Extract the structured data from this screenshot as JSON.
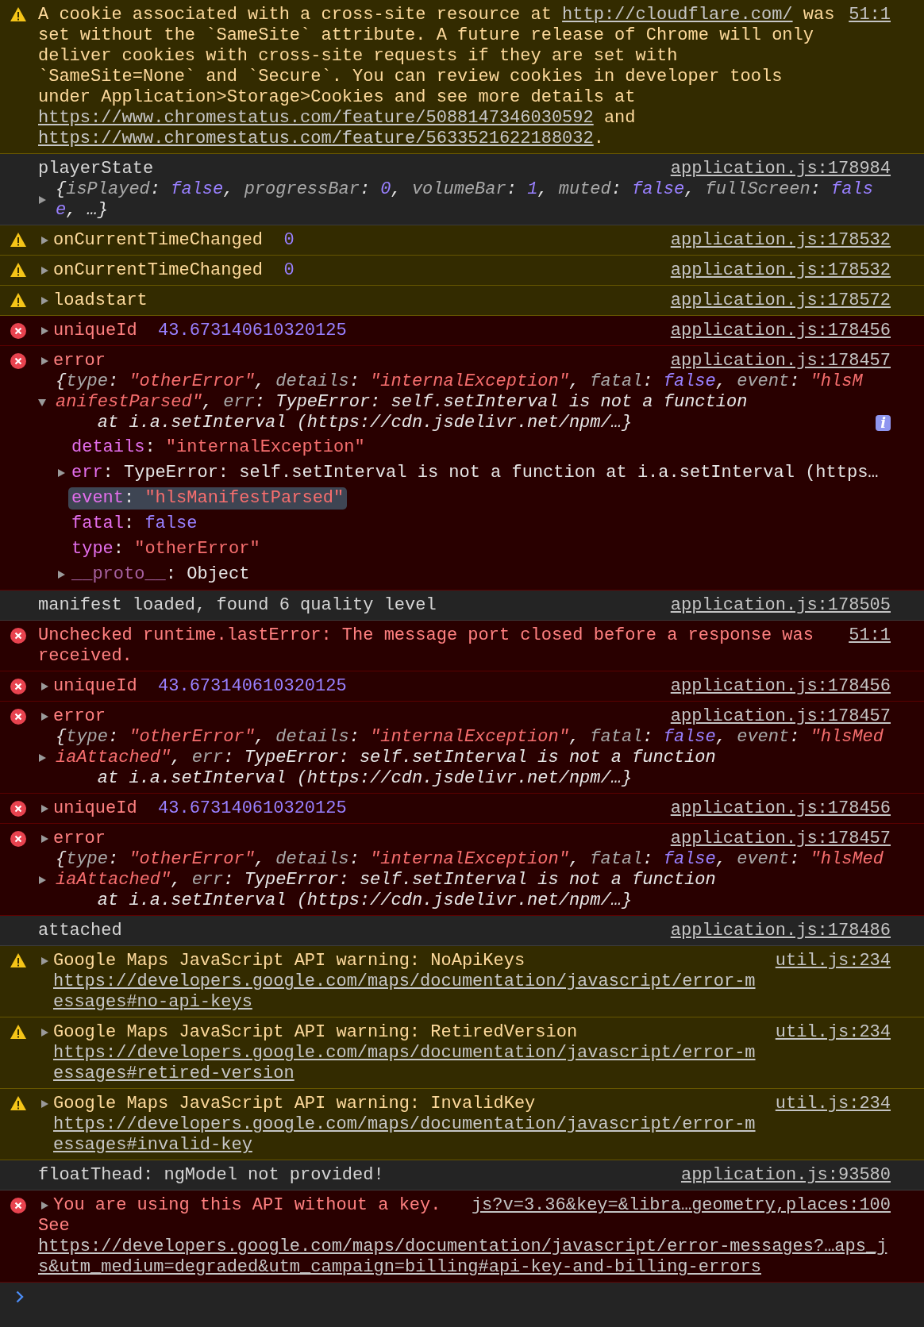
{
  "messages": [
    {
      "kind": "warning",
      "expandable": false,
      "source": "51:1",
      "parts": [
        {
          "kind": "text",
          "text": "A cookie associated with a cross-site resource at "
        },
        {
          "kind": "link",
          "text": "http://cloudflare.com/"
        },
        {
          "kind": "text",
          "text": " was set without the `SameSite` attribute. A future release of Chrome will only deliver cookies with cross-site requests if they are set with `SameSite=None` and `Secure`. You can review cookies in developer tools under Application>Storage>Cookies and see more details at "
        },
        {
          "kind": "link",
          "text": "https://www.chromestatus.com/feature/5088147346030592"
        },
        {
          "kind": "text",
          "text": " and "
        },
        {
          "kind": "link",
          "text": "https://www.chromestatus.com/feature/5633521622188032"
        },
        {
          "kind": "text",
          "text": "."
        }
      ]
    },
    {
      "kind": "info",
      "expandable": false,
      "source": "application.js:178984",
      "parts": [
        {
          "kind": "text",
          "text": "playerState"
        }
      ],
      "preview": {
        "expandable": true,
        "expanded": false,
        "parts": [
          {
            "kind": "text",
            "text": "{"
          },
          {
            "kind": "key",
            "text": "isPlayed"
          },
          {
            "kind": "text",
            "text": ": "
          },
          {
            "kind": "boolean",
            "text": "false"
          },
          {
            "kind": "text",
            "text": ", "
          },
          {
            "kind": "key",
            "text": "progressBar"
          },
          {
            "kind": "text",
            "text": ": "
          },
          {
            "kind": "number",
            "text": "0"
          },
          {
            "kind": "text",
            "text": ", "
          },
          {
            "kind": "key",
            "text": "volumeBar"
          },
          {
            "kind": "text",
            "text": ": "
          },
          {
            "kind": "number",
            "text": "1"
          },
          {
            "kind": "text",
            "text": ", "
          },
          {
            "kind": "key",
            "text": "muted"
          },
          {
            "kind": "text",
            "text": ": "
          },
          {
            "kind": "boolean",
            "text": "false"
          },
          {
            "kind": "text",
            "text": ", "
          },
          {
            "kind": "key",
            "text": "fullScreen"
          },
          {
            "kind": "text",
            "text": ": "
          },
          {
            "kind": "boolean",
            "text": "false"
          },
          {
            "kind": "text",
            "text": ", …}"
          }
        ]
      }
    },
    {
      "kind": "warning",
      "expandable": true,
      "expanded": false,
      "source": "application.js:178532",
      "parts": [
        {
          "kind": "text",
          "text": "onCurrentTimeChanged  "
        },
        {
          "kind": "number",
          "text": "0"
        }
      ]
    },
    {
      "kind": "warning",
      "expandable": true,
      "expanded": false,
      "source": "application.js:178532",
      "parts": [
        {
          "kind": "text",
          "text": "onCurrentTimeChanged  "
        },
        {
          "kind": "number",
          "text": "0"
        }
      ]
    },
    {
      "kind": "warning",
      "expandable": true,
      "expanded": false,
      "source": "application.js:178572",
      "parts": [
        {
          "kind": "text",
          "text": "loadstart"
        }
      ]
    },
    {
      "kind": "error",
      "expandable": true,
      "expanded": false,
      "source": "application.js:178456",
      "parts": [
        {
          "kind": "text",
          "text": "uniqueId  "
        },
        {
          "kind": "number",
          "text": "43.673140610320125"
        }
      ]
    },
    {
      "kind": "error",
      "expandable": true,
      "expanded": false,
      "source": "application.js:178457",
      "parts": [
        {
          "kind": "text",
          "text": "error"
        }
      ],
      "preview": {
        "expandable": true,
        "expanded": true,
        "badge": "i",
        "parts": [
          {
            "kind": "text",
            "text": "{"
          },
          {
            "kind": "key",
            "text": "type"
          },
          {
            "kind": "text",
            "text": ": "
          },
          {
            "kind": "string",
            "text": "\"otherError\""
          },
          {
            "kind": "text",
            "text": ", "
          },
          {
            "kind": "key",
            "text": "details"
          },
          {
            "kind": "text",
            "text": ": "
          },
          {
            "kind": "string",
            "text": "\"internalException\""
          },
          {
            "kind": "text",
            "text": ", "
          },
          {
            "kind": "key",
            "text": "fatal"
          },
          {
            "kind": "text",
            "text": ": "
          },
          {
            "kind": "boolean",
            "text": "false"
          },
          {
            "kind": "text",
            "text": ", "
          },
          {
            "kind": "key",
            "text": "event"
          },
          {
            "kind": "text",
            "text": ": "
          },
          {
            "kind": "string",
            "text": "\"hlsManifestParsed\""
          },
          {
            "kind": "text",
            "text": ", "
          },
          {
            "kind": "key",
            "text": "err"
          },
          {
            "kind": "text",
            "text": ": TypeError: self.setInterval is not a function\n    at i.a.setInterval (https://cdn.jsdelivr.net/npm/…}"
          }
        ],
        "properties": [
          {
            "name": "details",
            "internal": false,
            "separator": ": ",
            "value": "\"internalException\"",
            "kind": "string",
            "expandable": false,
            "selected": false
          },
          {
            "name": "err",
            "internal": false,
            "separator": ": ",
            "value": "TypeError: self.setInterval is not a function at i.a.setInterval (https…",
            "kind": "text",
            "expandable": true,
            "expanded": false,
            "selected": false
          },
          {
            "name": "event",
            "internal": false,
            "separator": ": ",
            "value": "\"hlsManifestParsed\"",
            "kind": "string",
            "expandable": false,
            "selected": true
          },
          {
            "name": "fatal",
            "internal": false,
            "separator": ": ",
            "value": "false",
            "kind": "boolean",
            "expandable": false,
            "selected": false
          },
          {
            "name": "type",
            "internal": false,
            "separator": ": ",
            "value": "\"otherError\"",
            "kind": "string",
            "expandable": false,
            "selected": false
          },
          {
            "name": "__proto__",
            "internal": true,
            "separator": ": ",
            "value": "Object",
            "kind": "text",
            "expandable": true,
            "expanded": false,
            "selected": false
          }
        ]
      }
    },
    {
      "kind": "info",
      "expandable": false,
      "source": "application.js:178505",
      "parts": [
        {
          "kind": "text",
          "text": "manifest loaded, found 6 quality level"
        }
      ]
    },
    {
      "kind": "error",
      "expandable": false,
      "source": "51:1",
      "parts": [
        {
          "kind": "text",
          "text": "Unchecked runtime.lastError: The message port closed before a response was received."
        }
      ]
    },
    {
      "kind": "error",
      "expandable": true,
      "expanded": false,
      "source": "application.js:178456",
      "parts": [
        {
          "kind": "text",
          "text": "uniqueId  "
        },
        {
          "kind": "number",
          "text": "43.673140610320125"
        }
      ]
    },
    {
      "kind": "error",
      "expandable": true,
      "expanded": false,
      "source": "application.js:178457",
      "parts": [
        {
          "kind": "text",
          "text": "error"
        }
      ],
      "preview": {
        "expandable": true,
        "expanded": false,
        "parts": [
          {
            "kind": "text",
            "text": "{"
          },
          {
            "kind": "key",
            "text": "type"
          },
          {
            "kind": "text",
            "text": ": "
          },
          {
            "kind": "string",
            "text": "\"otherError\""
          },
          {
            "kind": "text",
            "text": ", "
          },
          {
            "kind": "key",
            "text": "details"
          },
          {
            "kind": "text",
            "text": ": "
          },
          {
            "kind": "string",
            "text": "\"internalException\""
          },
          {
            "kind": "text",
            "text": ", "
          },
          {
            "kind": "key",
            "text": "fatal"
          },
          {
            "kind": "text",
            "text": ": "
          },
          {
            "kind": "boolean",
            "text": "false"
          },
          {
            "kind": "text",
            "text": ", "
          },
          {
            "kind": "key",
            "text": "event"
          },
          {
            "kind": "text",
            "text": ": "
          },
          {
            "kind": "string",
            "text": "\"hlsMediaAttached\""
          },
          {
            "kind": "text",
            "text": ", "
          },
          {
            "kind": "key",
            "text": "err"
          },
          {
            "kind": "text",
            "text": ": TypeError: self.setInterval is not a function\n    at i.a.setInterval (https://cdn.jsdelivr.net/npm/…}"
          }
        ]
      }
    },
    {
      "kind": "error",
      "expandable": true,
      "expanded": false,
      "source": "application.js:178456",
      "parts": [
        {
          "kind": "text",
          "text": "uniqueId  "
        },
        {
          "kind": "number",
          "text": "43.673140610320125"
        }
      ]
    },
    {
      "kind": "error",
      "expandable": true,
      "expanded": false,
      "source": "application.js:178457",
      "parts": [
        {
          "kind": "text",
          "text": "error"
        }
      ],
      "preview": {
        "expandable": true,
        "expanded": false,
        "parts": [
          {
            "kind": "text",
            "text": "{"
          },
          {
            "kind": "key",
            "text": "type"
          },
          {
            "kind": "text",
            "text": ": "
          },
          {
            "kind": "string",
            "text": "\"otherError\""
          },
          {
            "kind": "text",
            "text": ", "
          },
          {
            "kind": "key",
            "text": "details"
          },
          {
            "kind": "text",
            "text": ": "
          },
          {
            "kind": "string",
            "text": "\"internalException\""
          },
          {
            "kind": "text",
            "text": ", "
          },
          {
            "kind": "key",
            "text": "fatal"
          },
          {
            "kind": "text",
            "text": ": "
          },
          {
            "kind": "boolean",
            "text": "false"
          },
          {
            "kind": "text",
            "text": ", "
          },
          {
            "kind": "key",
            "text": "event"
          },
          {
            "kind": "text",
            "text": ": "
          },
          {
            "kind": "string",
            "text": "\"hlsMediaAttached\""
          },
          {
            "kind": "text",
            "text": ", "
          },
          {
            "kind": "key",
            "text": "err"
          },
          {
            "kind": "text",
            "text": ": TypeError: self.setInterval is not a function\n    at i.a.setInterval (https://cdn.jsdelivr.net/npm/…}"
          }
        ]
      }
    },
    {
      "kind": "info",
      "expandable": false,
      "source": "application.js:178486",
      "parts": [
        {
          "kind": "text",
          "text": "attached"
        }
      ]
    },
    {
      "kind": "warning",
      "expandable": true,
      "expanded": false,
      "source": "util.js:234",
      "parts": [
        {
          "kind": "text",
          "text": "Google Maps JavaScript API warning: NoApiKeys "
        },
        {
          "kind": "link",
          "text": "https://developers.google.com/maps/documentation/javascript/error-messages#no-api-keys"
        }
      ]
    },
    {
      "kind": "warning",
      "expandable": true,
      "expanded": false,
      "source": "util.js:234",
      "parts": [
        {
          "kind": "text",
          "text": "Google Maps JavaScript API warning: RetiredVersion "
        },
        {
          "kind": "link",
          "text": "https://developers.google.com/maps/documentation/javascript/error-messages#retired-version"
        }
      ]
    },
    {
      "kind": "warning",
      "expandable": true,
      "expanded": false,
      "source": "util.js:234",
      "parts": [
        {
          "kind": "text",
          "text": "Google Maps JavaScript API warning: InvalidKey "
        },
        {
          "kind": "link",
          "text": "https://developers.google.com/maps/documentation/javascript/error-messages#invalid-key"
        }
      ]
    },
    {
      "kind": "info",
      "expandable": false,
      "source": "application.js:93580",
      "parts": [
        {
          "kind": "text",
          "text": "floatThead: ngModel not provided!"
        }
      ]
    },
    {
      "kind": "error",
      "expandable": true,
      "expanded": false,
      "source": "js?v=3.36&key=&libra…geometry,places:100",
      "parts": [
        {
          "kind": "text",
          "text": "You are using this API without a key."
        }
      ],
      "detail": [
        {
          "kind": "text",
          "text": "See "
        },
        {
          "kind": "link",
          "text": "https://developers.google.com/maps/documentation/javascript/error-messages?…aps_js&utm_medium=degraded&utm_campaign=billing#api-key-and-billing-errors"
        }
      ]
    }
  ]
}
